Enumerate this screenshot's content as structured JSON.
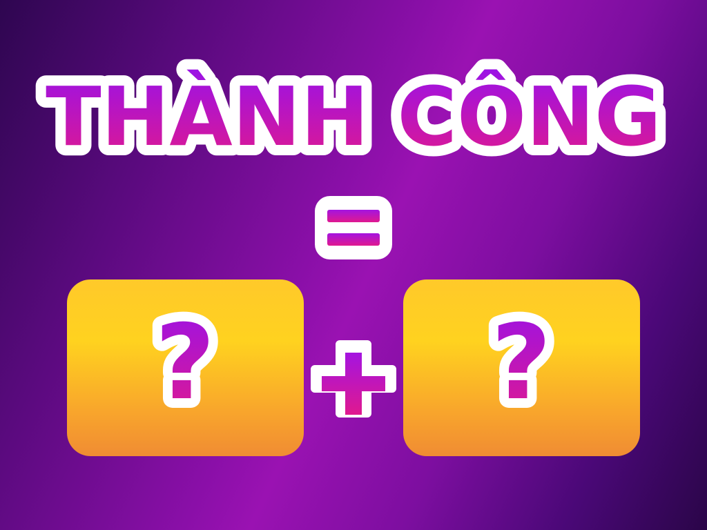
{
  "headline": "THÀNH CÔNG",
  "operator_equals": "=",
  "operator_plus": "+",
  "unknown_left": "?",
  "unknown_right": "?",
  "colors": {
    "text_top": "#9b12e6",
    "text_bottom": "#e0198f",
    "outline": "#ffffff",
    "card_top": "#ffc92a",
    "card_bottom": "#f08c33",
    "bg_dark": "#2e0650",
    "bg_light": "#9a12b2"
  }
}
